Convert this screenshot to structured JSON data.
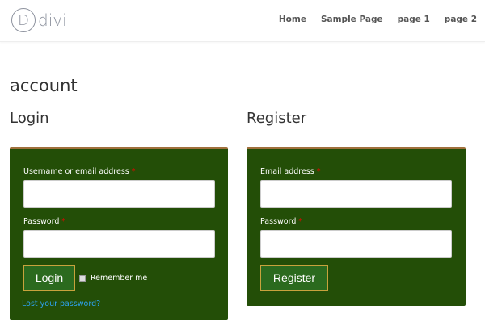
{
  "header": {
    "logo_letter": "D",
    "logo_text": "divi",
    "nav": [
      "Home",
      "Sample Page",
      "page 1",
      "page 2"
    ]
  },
  "page_title": "account",
  "login": {
    "title": "Login",
    "username_label": "Username or email address",
    "password_label": "Password",
    "required": "*",
    "username_value": "",
    "password_value": "",
    "button": "Login",
    "remember": "Remember me",
    "lost": "Lost your password?"
  },
  "register": {
    "title": "Register",
    "email_label": "Email address",
    "password_label": "Password",
    "required": "*",
    "email_value": "",
    "password_value": "",
    "button": "Register"
  },
  "colors": {
    "panel": "#234e07",
    "panel_border": "#a0703c",
    "link": "#2ea3f2"
  }
}
